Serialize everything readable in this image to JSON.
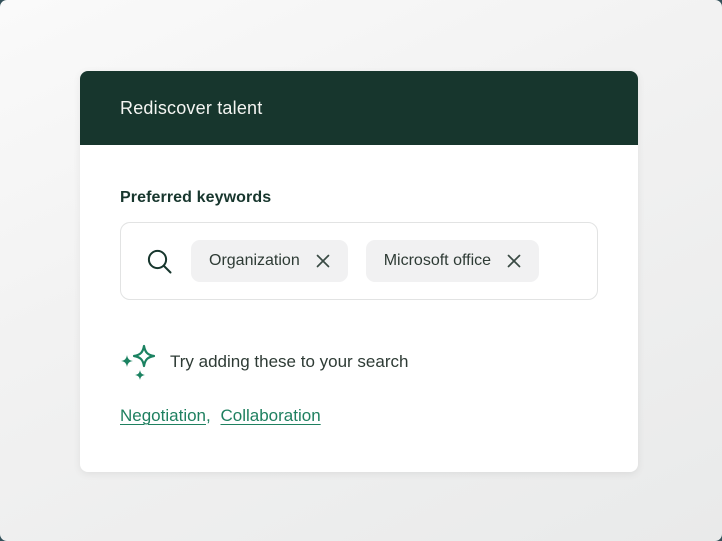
{
  "card": {
    "header": {
      "title": "Rediscover talent"
    },
    "section": {
      "label": "Preferred keywords",
      "search": {
        "chips": [
          {
            "label": "Organization"
          },
          {
            "label": "Microsoft office"
          }
        ]
      },
      "suggestion": {
        "text": "Try adding these to your search",
        "links": [
          "Negotiation",
          "Collaboration"
        ],
        "separator": ","
      }
    }
  },
  "colors": {
    "header_bg": "#17362d",
    "link_green": "#1f8060",
    "sparkle_green": "#1b8261",
    "chip_bg": "#f1f1f2",
    "text_dark": "#2e3b35",
    "page_bg_behind": "#33515a"
  },
  "icons": {
    "search": "search-icon",
    "chip_close": "close-icon",
    "sparkles": "sparkles-icon"
  }
}
